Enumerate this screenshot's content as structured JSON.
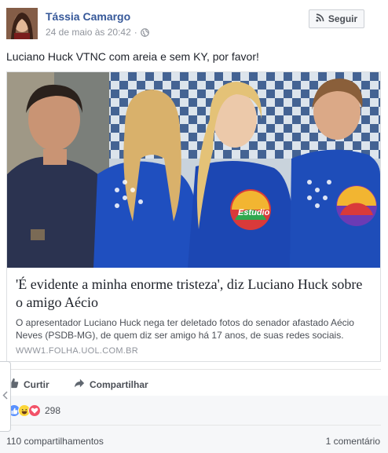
{
  "post": {
    "author": "Tássia Camargo",
    "timestamp": "24 de maio às 20:42",
    "separator": "·",
    "audience_icon": "globe-icon",
    "follow_label": "Seguir",
    "text": "Luciano Huck VTNC com areia e sem KY, por favor!"
  },
  "link_card": {
    "title": "'É evidente a minha enorme tristeza', diz Luciano Huck sobre o amigo Aécio",
    "description": "O apresentador Luciano Huck nega ter deletado fotos do senador afastado Aécio Neves (PSDB-MG), de quem diz ser amigo há 17 anos, de suas redes sociais.",
    "domain": "WWW1.FOLHA.UOL.COM.BR",
    "shirt_logo_text": "Estudio"
  },
  "actions": {
    "like_label": "Curtir",
    "share_label": "Compartilhar"
  },
  "feedback": {
    "reaction_icons": [
      "like-icon",
      "haha-icon",
      "love-icon"
    ],
    "reaction_count": "298",
    "shares": "110 compartilhamentos",
    "comments": "1 comentário"
  },
  "colors": {
    "link_blue": "#365899",
    "text": "#1d2129",
    "muted": "#90949c",
    "like_blue": "#5890ff",
    "love_red": "#f25268",
    "haha_yellow": "#fcd63a"
  }
}
